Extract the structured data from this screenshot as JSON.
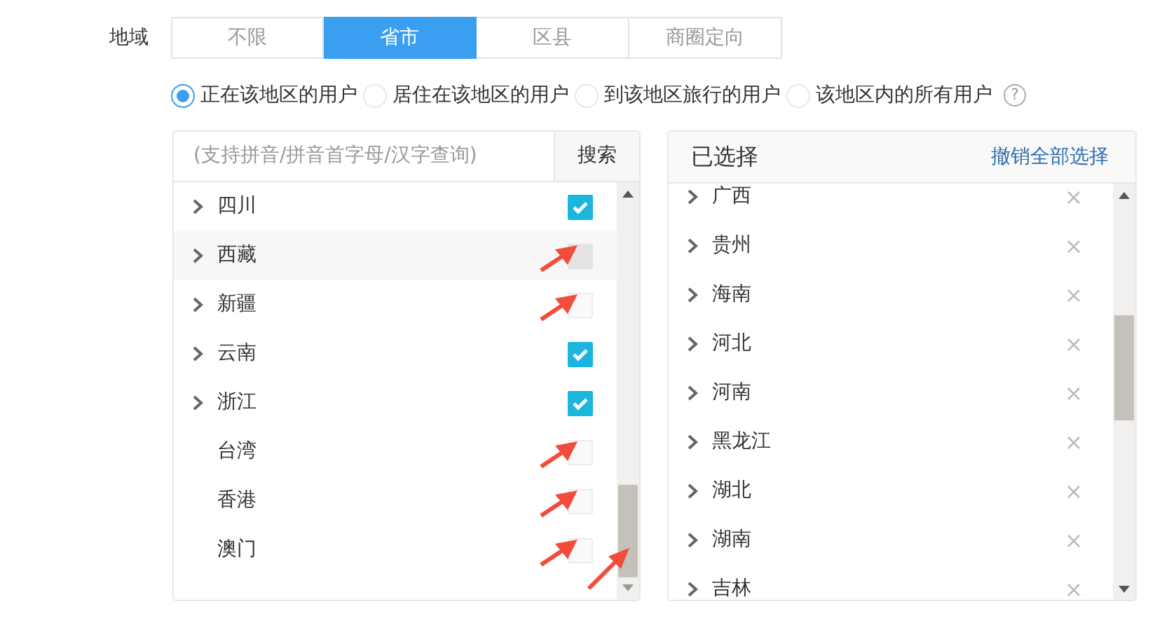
{
  "field_label": "地域",
  "tabs": [
    {
      "label": "不限",
      "selected": false
    },
    {
      "label": "省市",
      "selected": true
    },
    {
      "label": "区县",
      "selected": false
    },
    {
      "label": "商圈定向",
      "selected": false
    }
  ],
  "audience_options": [
    {
      "label": "正在该地区的用户",
      "selected": true
    },
    {
      "label": "居住在该地区的用户",
      "selected": false
    },
    {
      "label": "到该地区旅行的用户",
      "selected": false
    },
    {
      "label": "该地区内的所有用户",
      "selected": false
    }
  ],
  "help": "?",
  "search": {
    "placeholder": "(支持拼音/拼音首字母/汉字查询)",
    "button": "搜索"
  },
  "provinces": [
    {
      "name": "四川",
      "expandable": true,
      "checked": true,
      "hovered": false,
      "annotated": false
    },
    {
      "name": "西藏",
      "expandable": true,
      "checked": false,
      "hovered": true,
      "annotated": true
    },
    {
      "name": "新疆",
      "expandable": true,
      "checked": false,
      "hovered": false,
      "annotated": true
    },
    {
      "name": "云南",
      "expandable": true,
      "checked": true,
      "hovered": false,
      "annotated": false
    },
    {
      "name": "浙江",
      "expandable": true,
      "checked": true,
      "hovered": false,
      "annotated": false
    },
    {
      "name": "台湾",
      "expandable": false,
      "checked": false,
      "hovered": false,
      "annotated": true
    },
    {
      "name": "香港",
      "expandable": false,
      "checked": false,
      "hovered": false,
      "annotated": true
    },
    {
      "name": "澳门",
      "expandable": false,
      "checked": false,
      "hovered": false,
      "annotated": true
    }
  ],
  "scrollbar_annotated": true,
  "selected_panel": {
    "title": "已选择",
    "clear_link": "撤销全部选择",
    "items": [
      {
        "name": "广西",
        "expandable": true
      },
      {
        "name": "贵州",
        "expandable": true
      },
      {
        "name": "海南",
        "expandable": true
      },
      {
        "name": "河北",
        "expandable": true
      },
      {
        "name": "河南",
        "expandable": true
      },
      {
        "name": "黑龙江",
        "expandable": true
      },
      {
        "name": "湖北",
        "expandable": true
      },
      {
        "name": "湖南",
        "expandable": true
      },
      {
        "name": "吉林",
        "expandable": true
      }
    ]
  }
}
